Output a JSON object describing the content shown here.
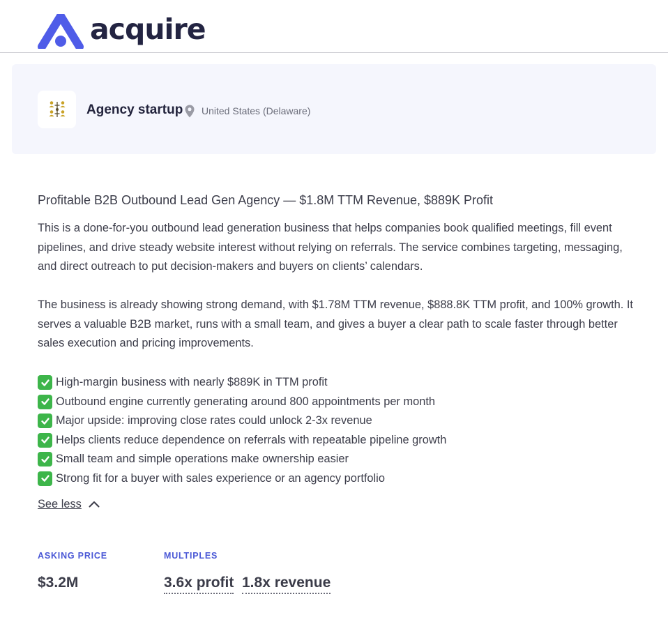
{
  "brand": {
    "name": "acquire",
    "logo_icon": "acquire-logo-icon",
    "color": "#4f5ce8"
  },
  "listing_card": {
    "title": "Agency startup",
    "location": "United States (Delaware)",
    "avatar_icon": "people-network-icon",
    "location_icon": "map-pin-icon"
  },
  "listing": {
    "title": "Profitable B2B Outbound Lead Gen Agency — $1.8M TTM Revenue, $889K Profit",
    "paragraphs": [
      "This is a done-for-you outbound lead generation business that helps companies book qualified meetings, fill event pipelines, and drive steady website interest without relying on referrals. The service combines targeting, messaging, and direct outreach to put decision-makers and buyers on clients’ calendars.",
      "The business is already showing strong demand, with $1.78M TTM revenue, $888.8K TTM profit, and 100% growth. It serves a valuable B2B market, runs with a small team, and gives a buyer a clear path to scale faster through better sales execution and pricing improvements."
    ],
    "bullets": [
      "High-margin business with nearly $889K in TTM profit",
      "Outbound engine currently generating around 800 appointments per month",
      "Major upside: improving close rates could unlock 2-3x revenue",
      "Helps clients reduce dependence on referrals with repeatable pipeline growth",
      "Small team and simple operations make ownership easier",
      "Strong fit for a buyer with sales experience or an agency portfolio"
    ],
    "bullet_icon": "check-mark-icon",
    "see_less_label": "See less"
  },
  "financials": {
    "asking_price_label": "ASKING PRICE",
    "asking_price": "$3.2M",
    "multiples_label": "MULTIPLES",
    "profit_multiple": "3.6x profit",
    "revenue_multiple": "1.8x revenue"
  }
}
